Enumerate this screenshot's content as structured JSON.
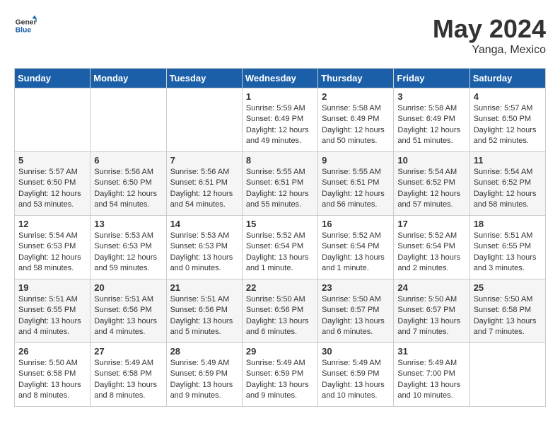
{
  "header": {
    "logo_line1": "General",
    "logo_line2": "Blue",
    "month": "May 2024",
    "location": "Yanga, Mexico"
  },
  "weekdays": [
    "Sunday",
    "Monday",
    "Tuesday",
    "Wednesday",
    "Thursday",
    "Friday",
    "Saturday"
  ],
  "weeks": [
    [
      {
        "day": "",
        "info": ""
      },
      {
        "day": "",
        "info": ""
      },
      {
        "day": "",
        "info": ""
      },
      {
        "day": "1",
        "info": "Sunrise: 5:59 AM\nSunset: 6:49 PM\nDaylight: 12 hours\nand 49 minutes."
      },
      {
        "day": "2",
        "info": "Sunrise: 5:58 AM\nSunset: 6:49 PM\nDaylight: 12 hours\nand 50 minutes."
      },
      {
        "day": "3",
        "info": "Sunrise: 5:58 AM\nSunset: 6:49 PM\nDaylight: 12 hours\nand 51 minutes."
      },
      {
        "day": "4",
        "info": "Sunrise: 5:57 AM\nSunset: 6:50 PM\nDaylight: 12 hours\nand 52 minutes."
      }
    ],
    [
      {
        "day": "5",
        "info": "Sunrise: 5:57 AM\nSunset: 6:50 PM\nDaylight: 12 hours\nand 53 minutes."
      },
      {
        "day": "6",
        "info": "Sunrise: 5:56 AM\nSunset: 6:50 PM\nDaylight: 12 hours\nand 54 minutes."
      },
      {
        "day": "7",
        "info": "Sunrise: 5:56 AM\nSunset: 6:51 PM\nDaylight: 12 hours\nand 54 minutes."
      },
      {
        "day": "8",
        "info": "Sunrise: 5:55 AM\nSunset: 6:51 PM\nDaylight: 12 hours\nand 55 minutes."
      },
      {
        "day": "9",
        "info": "Sunrise: 5:55 AM\nSunset: 6:51 PM\nDaylight: 12 hours\nand 56 minutes."
      },
      {
        "day": "10",
        "info": "Sunrise: 5:54 AM\nSunset: 6:52 PM\nDaylight: 12 hours\nand 57 minutes."
      },
      {
        "day": "11",
        "info": "Sunrise: 5:54 AM\nSunset: 6:52 PM\nDaylight: 12 hours\nand 58 minutes."
      }
    ],
    [
      {
        "day": "12",
        "info": "Sunrise: 5:54 AM\nSunset: 6:53 PM\nDaylight: 12 hours\nand 58 minutes."
      },
      {
        "day": "13",
        "info": "Sunrise: 5:53 AM\nSunset: 6:53 PM\nDaylight: 12 hours\nand 59 minutes."
      },
      {
        "day": "14",
        "info": "Sunrise: 5:53 AM\nSunset: 6:53 PM\nDaylight: 13 hours\nand 0 minutes."
      },
      {
        "day": "15",
        "info": "Sunrise: 5:52 AM\nSunset: 6:54 PM\nDaylight: 13 hours\nand 1 minute."
      },
      {
        "day": "16",
        "info": "Sunrise: 5:52 AM\nSunset: 6:54 PM\nDaylight: 13 hours\nand 1 minute."
      },
      {
        "day": "17",
        "info": "Sunrise: 5:52 AM\nSunset: 6:54 PM\nDaylight: 13 hours\nand 2 minutes."
      },
      {
        "day": "18",
        "info": "Sunrise: 5:51 AM\nSunset: 6:55 PM\nDaylight: 13 hours\nand 3 minutes."
      }
    ],
    [
      {
        "day": "19",
        "info": "Sunrise: 5:51 AM\nSunset: 6:55 PM\nDaylight: 13 hours\nand 4 minutes."
      },
      {
        "day": "20",
        "info": "Sunrise: 5:51 AM\nSunset: 6:56 PM\nDaylight: 13 hours\nand 4 minutes."
      },
      {
        "day": "21",
        "info": "Sunrise: 5:51 AM\nSunset: 6:56 PM\nDaylight: 13 hours\nand 5 minutes."
      },
      {
        "day": "22",
        "info": "Sunrise: 5:50 AM\nSunset: 6:56 PM\nDaylight: 13 hours\nand 6 minutes."
      },
      {
        "day": "23",
        "info": "Sunrise: 5:50 AM\nSunset: 6:57 PM\nDaylight: 13 hours\nand 6 minutes."
      },
      {
        "day": "24",
        "info": "Sunrise: 5:50 AM\nSunset: 6:57 PM\nDaylight: 13 hours\nand 7 minutes."
      },
      {
        "day": "25",
        "info": "Sunrise: 5:50 AM\nSunset: 6:58 PM\nDaylight: 13 hours\nand 7 minutes."
      }
    ],
    [
      {
        "day": "26",
        "info": "Sunrise: 5:50 AM\nSunset: 6:58 PM\nDaylight: 13 hours\nand 8 minutes."
      },
      {
        "day": "27",
        "info": "Sunrise: 5:49 AM\nSunset: 6:58 PM\nDaylight: 13 hours\nand 8 minutes."
      },
      {
        "day": "28",
        "info": "Sunrise: 5:49 AM\nSunset: 6:59 PM\nDaylight: 13 hours\nand 9 minutes."
      },
      {
        "day": "29",
        "info": "Sunrise: 5:49 AM\nSunset: 6:59 PM\nDaylight: 13 hours\nand 9 minutes."
      },
      {
        "day": "30",
        "info": "Sunrise: 5:49 AM\nSunset: 6:59 PM\nDaylight: 13 hours\nand 10 minutes."
      },
      {
        "day": "31",
        "info": "Sunrise: 5:49 AM\nSunset: 7:00 PM\nDaylight: 13 hours\nand 10 minutes."
      },
      {
        "day": "",
        "info": ""
      }
    ]
  ]
}
